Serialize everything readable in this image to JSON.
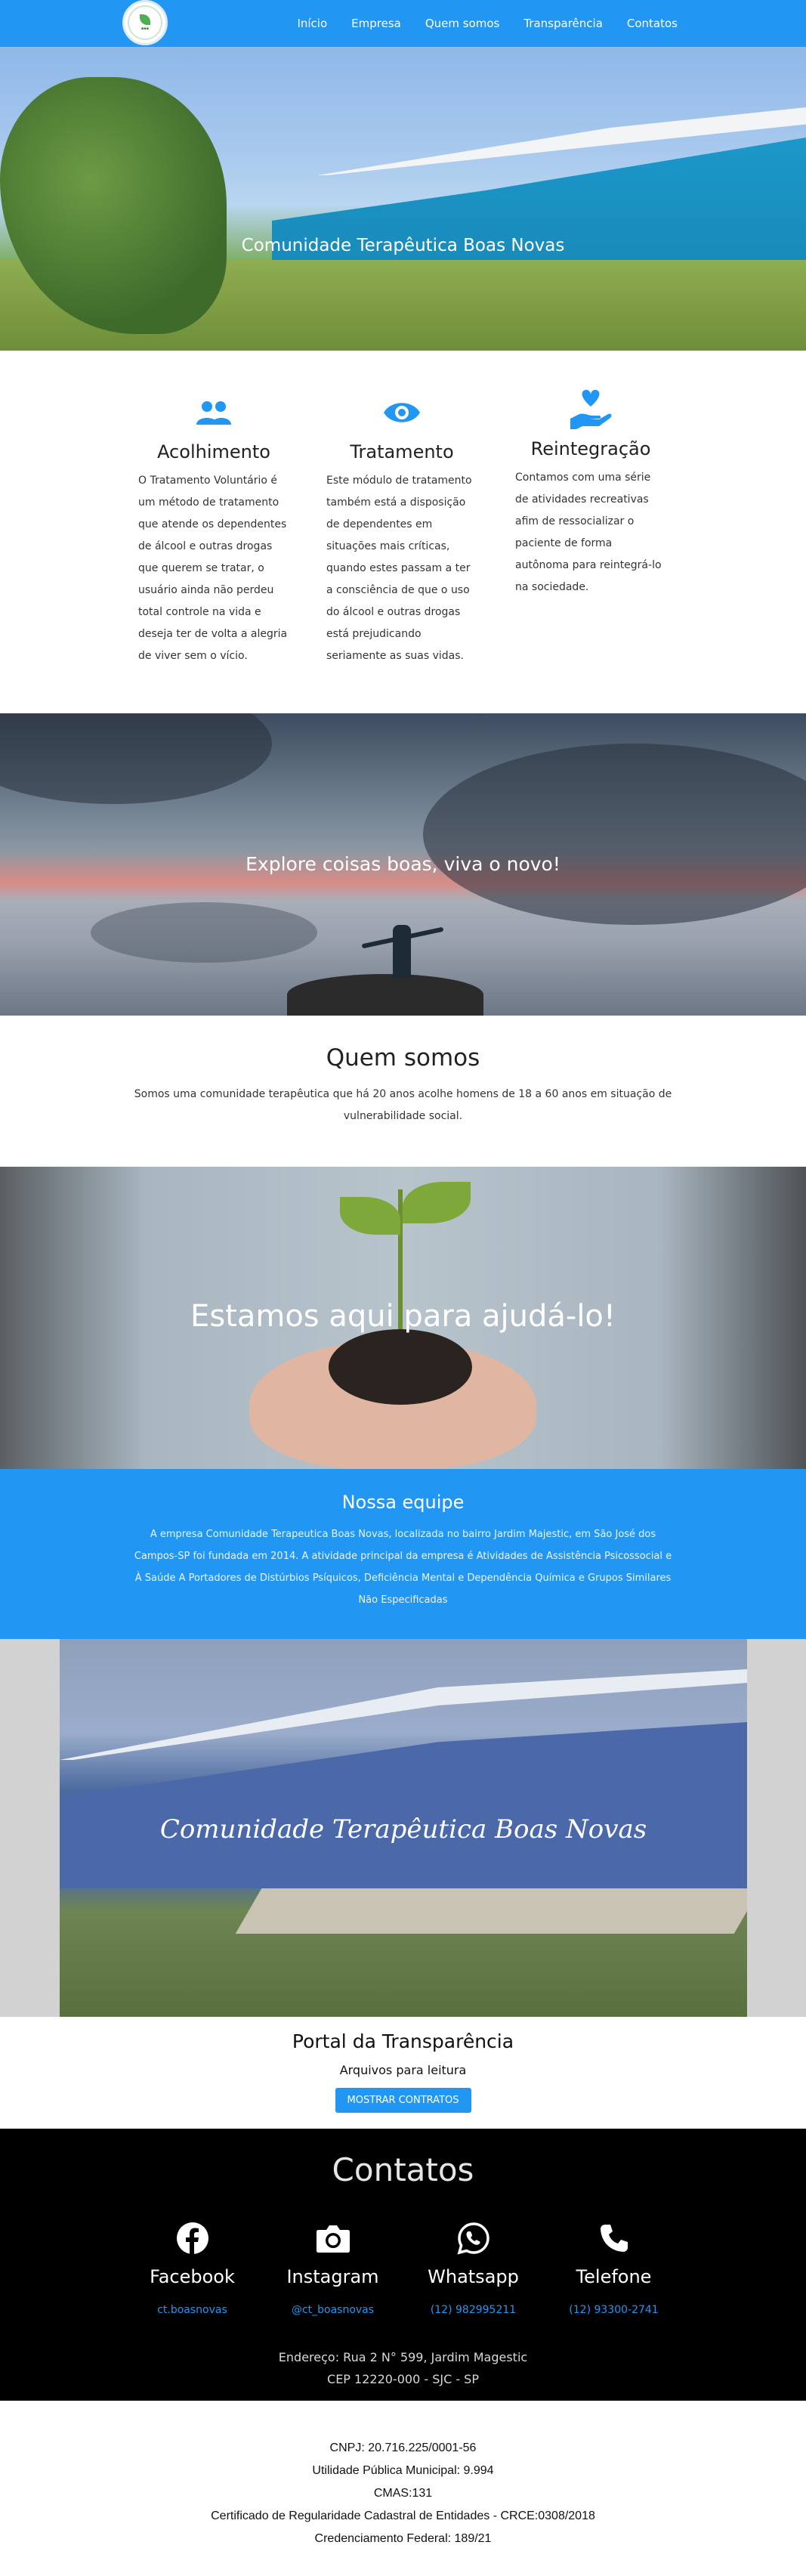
{
  "colors": {
    "primary": "#2196f3",
    "footer_bg": "#000000",
    "gray_band": "#d2d2d2"
  },
  "nav": {
    "logo_icon": "logo-icon",
    "items": [
      {
        "label": "Início"
      },
      {
        "label": "Empresa"
      },
      {
        "label": "Quem somos"
      },
      {
        "label": "Transparência"
      },
      {
        "label": "Contatos"
      }
    ]
  },
  "hero1": {
    "title": "Comunidade Terapêutica Boas Novas"
  },
  "features": [
    {
      "icon": "people-icon",
      "title": "Acolhimento",
      "text": "O Tratamento Voluntário é um método de tratamento que atende os dependentes de álcool e outras drogas que querem se tratar, o usuário ainda não perdeu total controle na vida e deseja ter de volta a alegria de viver sem o vício."
    },
    {
      "icon": "eye-icon",
      "title": "Tratamento",
      "text": "Este módulo de tratamento também está a disposição de dependentes em situações mais críticas, quando estes passam a ter a consciência de que o uso do álcool e outras drogas está prejudicando seriamente as suas vidas."
    },
    {
      "icon": "hand-heart-icon",
      "title": "Reintegração",
      "text": "Contamos com uma série de atividades recreativas afim de ressocializar o paciente de forma autônoma para reintegrá-lo na sociedade."
    }
  ],
  "hero2": {
    "title": "Explore coisas boas, viva o novo!"
  },
  "quem_somos": {
    "title": "Quem somos",
    "text": "Somos uma comunidade terapêutica que há 20 anos acolhe homens de 18 a 60 anos em situação de vulnerabilidade social."
  },
  "hero3": {
    "title": "Estamos aqui para ajudá-lo!"
  },
  "equipe": {
    "title": "Nossa equipe",
    "text": "A empresa Comunidade Terapeutica Boas Novas, localizada no bairro Jardim Majestic, em São José dos Campos-SP foi fundada em 2014. A atividade principal da empresa é Atividades de Assistência Psicossocial e À Saúde A Portadores de Distúrbios Psíquicos, Deficiência Mental e Dependência Química e Grupos Similares Não Especificadas"
  },
  "hero4": {
    "title": "Comunidade Terapêutica Boas Novas"
  },
  "transparencia": {
    "title": "Portal da Transparência",
    "subtitle": "Arquivos para leitura",
    "button": "MOSTRAR CONTRATOS"
  },
  "contatos": {
    "title": "Contatos",
    "items": [
      {
        "icon": "facebook-icon",
        "label": "Facebook",
        "value": "ct.boasnovas"
      },
      {
        "icon": "camera-icon",
        "label": "Instagram",
        "value": "@ct_boasnovas"
      },
      {
        "icon": "whatsapp-icon",
        "label": "Whatsapp",
        "value": "(12) 982995211"
      },
      {
        "icon": "phone-icon",
        "label": "Telefone",
        "value": "(12) 93300-2741"
      }
    ],
    "address_line1": "Endereço: Rua 2 N° 599, Jardim Magestic",
    "address_line2": "CEP 12220-000 - SJC - SP"
  },
  "footer": {
    "lines": [
      "CNPJ: 20.716.225/0001-56",
      "Utilidade Pública Municipal: 9.994",
      "CMAS:131",
      "Certificado de Regularidade Cadastral de Entidades - CRCE:0308/2018",
      "Credenciamento Federal: 189/21"
    ]
  }
}
